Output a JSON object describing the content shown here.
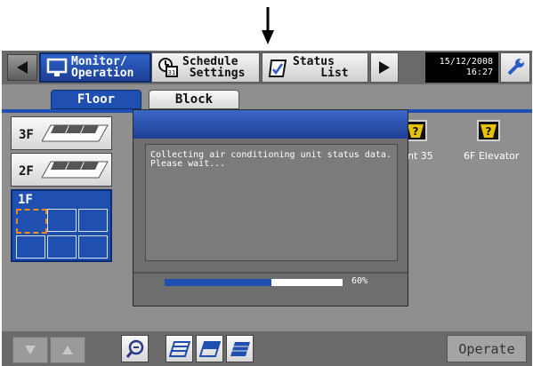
{
  "nav": {
    "monitor_operation": "Monitor/\nOperation",
    "schedule_settings": "Schedule\n Settings",
    "status_list": "Status\n    List",
    "date": "15/12/2008",
    "time": "16:27"
  },
  "tabs": {
    "floor": "Floor",
    "block": "Block"
  },
  "floors": [
    {
      "label": "3F"
    },
    {
      "label": "2F"
    },
    {
      "label": "1F"
    }
  ],
  "map": {
    "units": [
      {
        "label": "nt 35"
      },
      {
        "label": "6F Elevator"
      }
    ]
  },
  "dialog": {
    "message": "Collecting air conditioning unit status data.\nPlease wait...",
    "progress_label": "60%",
    "progress_fraction": 0.6
  },
  "toolbar": {
    "operate_label": "Operate"
  },
  "colors": {
    "accent": "#1f4fb0",
    "selection": "#f08a1a"
  }
}
